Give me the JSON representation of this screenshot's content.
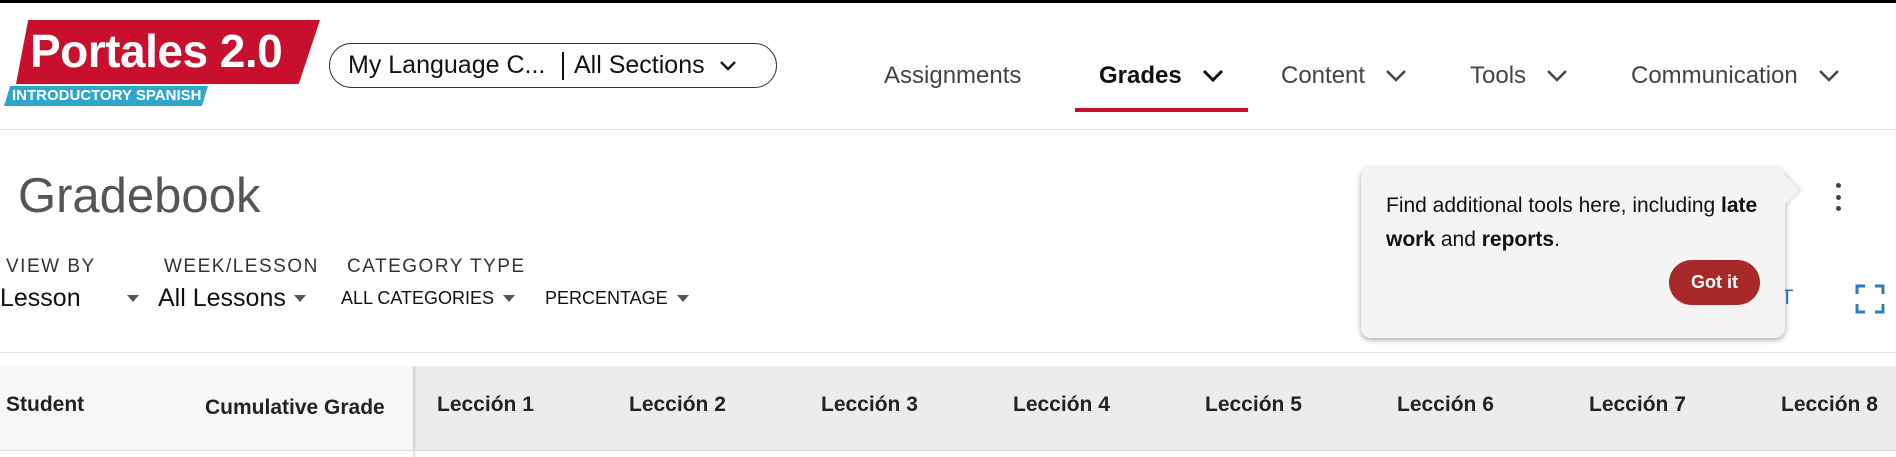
{
  "logo": {
    "title": "Portales 2.0",
    "subtitle": "INTRODUCTORY SPANISH",
    "colors": {
      "red": "#c8102e",
      "blue": "#2fa6c8"
    }
  },
  "course_selector": {
    "course": "My Language C...",
    "section": "All Sections",
    "icon": "chevron-down-icon"
  },
  "nav": {
    "items": [
      {
        "label": "Assignments",
        "active": false,
        "has_dropdown": false
      },
      {
        "label": "Grades",
        "active": true,
        "has_dropdown": true
      },
      {
        "label": "Content",
        "active": false,
        "has_dropdown": true
      },
      {
        "label": "Tools",
        "active": false,
        "has_dropdown": true
      },
      {
        "label": "Communication",
        "active": false,
        "has_dropdown": true
      }
    ],
    "active_color": "#c8102e"
  },
  "page": {
    "title": "Gradebook"
  },
  "filters": {
    "view_by": {
      "label": "VIEW BY",
      "value": "Lesson"
    },
    "week_lesson": {
      "label": "WEEK/LESSON",
      "value": "All Lessons"
    },
    "category_type": {
      "label": "CATEGORY TYPE",
      "value": "ALL CATEGORIES"
    },
    "display": {
      "value": "PERCENTAGE"
    }
  },
  "tools": {
    "more_icon": "more-vertical-icon",
    "export_partial": "RT",
    "fullscreen_icon": "fullscreen-icon"
  },
  "tooltip": {
    "text_prefix": "Find additional tools here, including ",
    "bold1": "late work",
    "text_mid": " and ",
    "bold2": "reports",
    "text_suffix": ".",
    "button": "Got it",
    "button_color": "#a8292a"
  },
  "table": {
    "headers": [
      "Student",
      "Cumulative Grade",
      "Lección 1",
      "Lección 2",
      "Lección 3",
      "Lección 4",
      "Lección 5",
      "Lección 6",
      "Lección 7",
      "Lección 8"
    ]
  }
}
